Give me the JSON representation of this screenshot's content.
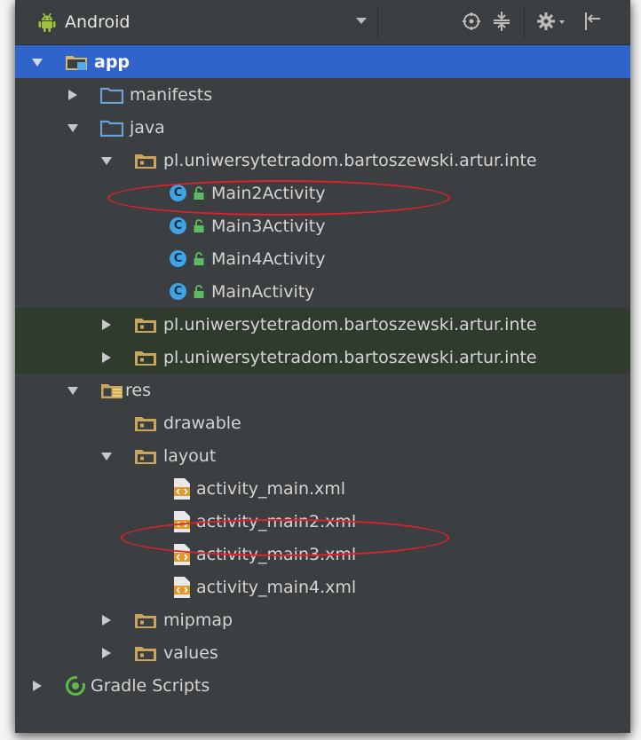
{
  "toolbar": {
    "view_mode": "Android"
  },
  "tree": {
    "app": "app",
    "manifests": "manifests",
    "java": "java",
    "pkg_main": "pl.uniwersytetradom.bartoszewski.artur.inte",
    "classes": [
      "Main2Activity",
      "Main3Activity",
      "Main4Activity",
      "MainActivity"
    ],
    "pkg_other_1": "pl.uniwersytetradom.bartoszewski.artur.inte",
    "pkg_other_2": "pl.uniwersytetradom.bartoszewski.artur.inte",
    "res": "res",
    "drawable": "drawable",
    "layout": "layout",
    "layout_files": [
      "activity_main.xml",
      "activity_main2.xml",
      "activity_main3.xml",
      "activity_main4.xml"
    ],
    "mipmap": "mipmap",
    "values": "values",
    "gradle_scripts": "Gradle Scripts"
  },
  "colors": {
    "panel_bg": "#3c3f41",
    "selection": "#2f65ca",
    "highlight_ellipse": "#e0202a",
    "folder_blue": "#6aa3d9",
    "folder_tan": "#c9a55d",
    "class_icon": "#3fa4e6"
  }
}
